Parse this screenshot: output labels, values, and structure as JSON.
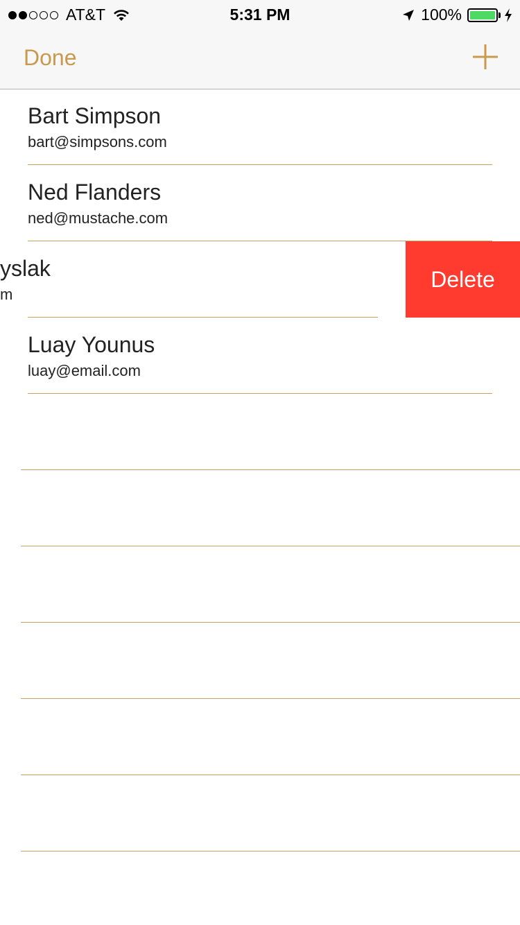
{
  "status_bar": {
    "carrier": "AT&T",
    "time": "5:31 PM",
    "battery": "100%",
    "signal_icon": "signal-dots-icon",
    "wifi_icon": "wifi-icon",
    "location_icon": "location-arrow-icon",
    "battery_icon": "battery-icon",
    "charging_icon": "charging-bolt-icon"
  },
  "nav": {
    "done_label": "Done",
    "add_icon": "plus-icon"
  },
  "contacts": [
    {
      "name": "Bart Simpson",
      "email": "bart@simpsons.com"
    },
    {
      "name": "Ned Flanders",
      "email": "ned@mustache.com"
    },
    {
      "name": "yslak",
      "email": "m"
    },
    {
      "name": "Luay Younus",
      "email": "luay@email.com"
    }
  ],
  "swipe_action": {
    "delete_label": "Delete"
  },
  "colors": {
    "accent": "#c79a4e",
    "separator": "#c7a15f",
    "delete": "#ff3b30",
    "battery": "#4cd964"
  }
}
